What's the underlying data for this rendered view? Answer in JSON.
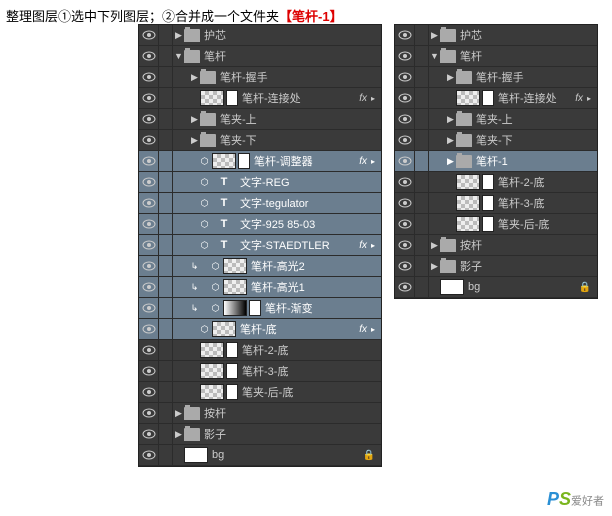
{
  "instruction": {
    "prefix": "整理图层①选中下列图层；②合并成一个文件夹",
    "highlight": "【笔杆-1】"
  },
  "leftPanel": {
    "rows": [
      {
        "indent": 0,
        "arrow": "▶",
        "kind": "folder",
        "label": "护芯",
        "sel": false
      },
      {
        "indent": 0,
        "arrow": "▼",
        "kind": "folder",
        "label": "笔杆",
        "sel": false
      },
      {
        "indent": 1,
        "arrow": "▶",
        "kind": "folder",
        "label": "笔杆-握手",
        "sel": false
      },
      {
        "indent": 1,
        "arrow": "",
        "kind": "layer-checker-mask",
        "label": "笔杆-连接处",
        "sel": false,
        "fx": true
      },
      {
        "indent": 1,
        "arrow": "▶",
        "kind": "folder",
        "label": "笔夹-上",
        "sel": false
      },
      {
        "indent": 1,
        "arrow": "▶",
        "kind": "folder",
        "label": "笔夹-下",
        "sel": false
      },
      {
        "indent": 1,
        "arrow": "",
        "kind": "layer-checker-mask",
        "label": "笔杆-调整器",
        "sel": true,
        "fx": true,
        "link": true
      },
      {
        "indent": 1,
        "arrow": "",
        "kind": "type",
        "label": "文字-REG",
        "sel": true,
        "link": true
      },
      {
        "indent": 1,
        "arrow": "",
        "kind": "type",
        "label": "文字-tegulator",
        "sel": true,
        "link": true
      },
      {
        "indent": 1,
        "arrow": "",
        "kind": "type",
        "label": "文字-925 85-03",
        "sel": true,
        "link": true
      },
      {
        "indent": 1,
        "arrow": "",
        "kind": "type",
        "label": "文字-STAEDTLER",
        "sel": true,
        "fx": true,
        "link": true
      },
      {
        "indent": 1,
        "arrow": "",
        "kind": "layer-checker",
        "label": "笔杆-高光2",
        "sel": true,
        "link": true,
        "arrowType": "clip"
      },
      {
        "indent": 1,
        "arrow": "",
        "kind": "layer-checker",
        "label": "笔杆-高光1",
        "sel": true,
        "link": true,
        "arrowType": "clip"
      },
      {
        "indent": 1,
        "arrow": "",
        "kind": "layer-gradient-mask",
        "label": "笔杆-渐变",
        "sel": true,
        "link": true,
        "arrowType": "clip"
      },
      {
        "indent": 1,
        "arrow": "",
        "kind": "layer-checker",
        "label": "笔杆-底",
        "sel": true,
        "fx": true,
        "link": true
      },
      {
        "indent": 1,
        "arrow": "",
        "kind": "layer-checker-mask",
        "label": "笔杆-2-底",
        "sel": false
      },
      {
        "indent": 1,
        "arrow": "",
        "kind": "layer-checker-mask",
        "label": "笔杆-3-底",
        "sel": false
      },
      {
        "indent": 1,
        "arrow": "",
        "kind": "layer-checker-mask",
        "label": "笔夹-后-底",
        "sel": false
      },
      {
        "indent": 0,
        "arrow": "▶",
        "kind": "folder",
        "label": "按杆",
        "sel": false
      },
      {
        "indent": 0,
        "arrow": "▶",
        "kind": "folder",
        "label": "影子",
        "sel": false
      },
      {
        "indent": 0,
        "arrow": "",
        "kind": "layer-white",
        "label": "bg",
        "sel": false,
        "lock": true
      }
    ]
  },
  "rightPanel": {
    "rows": [
      {
        "indent": 0,
        "arrow": "▶",
        "kind": "folder",
        "label": "护芯",
        "sel": false
      },
      {
        "indent": 0,
        "arrow": "▼",
        "kind": "folder",
        "label": "笔杆",
        "sel": false
      },
      {
        "indent": 1,
        "arrow": "▶",
        "kind": "folder",
        "label": "笔杆-握手",
        "sel": false
      },
      {
        "indent": 1,
        "arrow": "",
        "kind": "layer-checker-mask",
        "label": "笔杆-连接处",
        "sel": false,
        "fx": true
      },
      {
        "indent": 1,
        "arrow": "▶",
        "kind": "folder",
        "label": "笔夹-上",
        "sel": false
      },
      {
        "indent": 1,
        "arrow": "▶",
        "kind": "folder",
        "label": "笔夹-下",
        "sel": false
      },
      {
        "indent": 1,
        "arrow": "▶",
        "kind": "folder",
        "label": "笔杆-1",
        "sel": true
      },
      {
        "indent": 1,
        "arrow": "",
        "kind": "layer-checker-mask",
        "label": "笔杆-2-底",
        "sel": false
      },
      {
        "indent": 1,
        "arrow": "",
        "kind": "layer-checker-mask",
        "label": "笔杆-3-底",
        "sel": false
      },
      {
        "indent": 1,
        "arrow": "",
        "kind": "layer-checker-mask",
        "label": "笔夹-后-底",
        "sel": false
      },
      {
        "indent": 0,
        "arrow": "▶",
        "kind": "folder",
        "label": "按杆",
        "sel": false
      },
      {
        "indent": 0,
        "arrow": "▶",
        "kind": "folder",
        "label": "影子",
        "sel": false
      },
      {
        "indent": 0,
        "arrow": "",
        "kind": "layer-white",
        "label": "bg",
        "sel": false,
        "lock": true
      }
    ]
  },
  "watermark": {
    "p": "P",
    "s": "S",
    "cn": "爱好者"
  }
}
